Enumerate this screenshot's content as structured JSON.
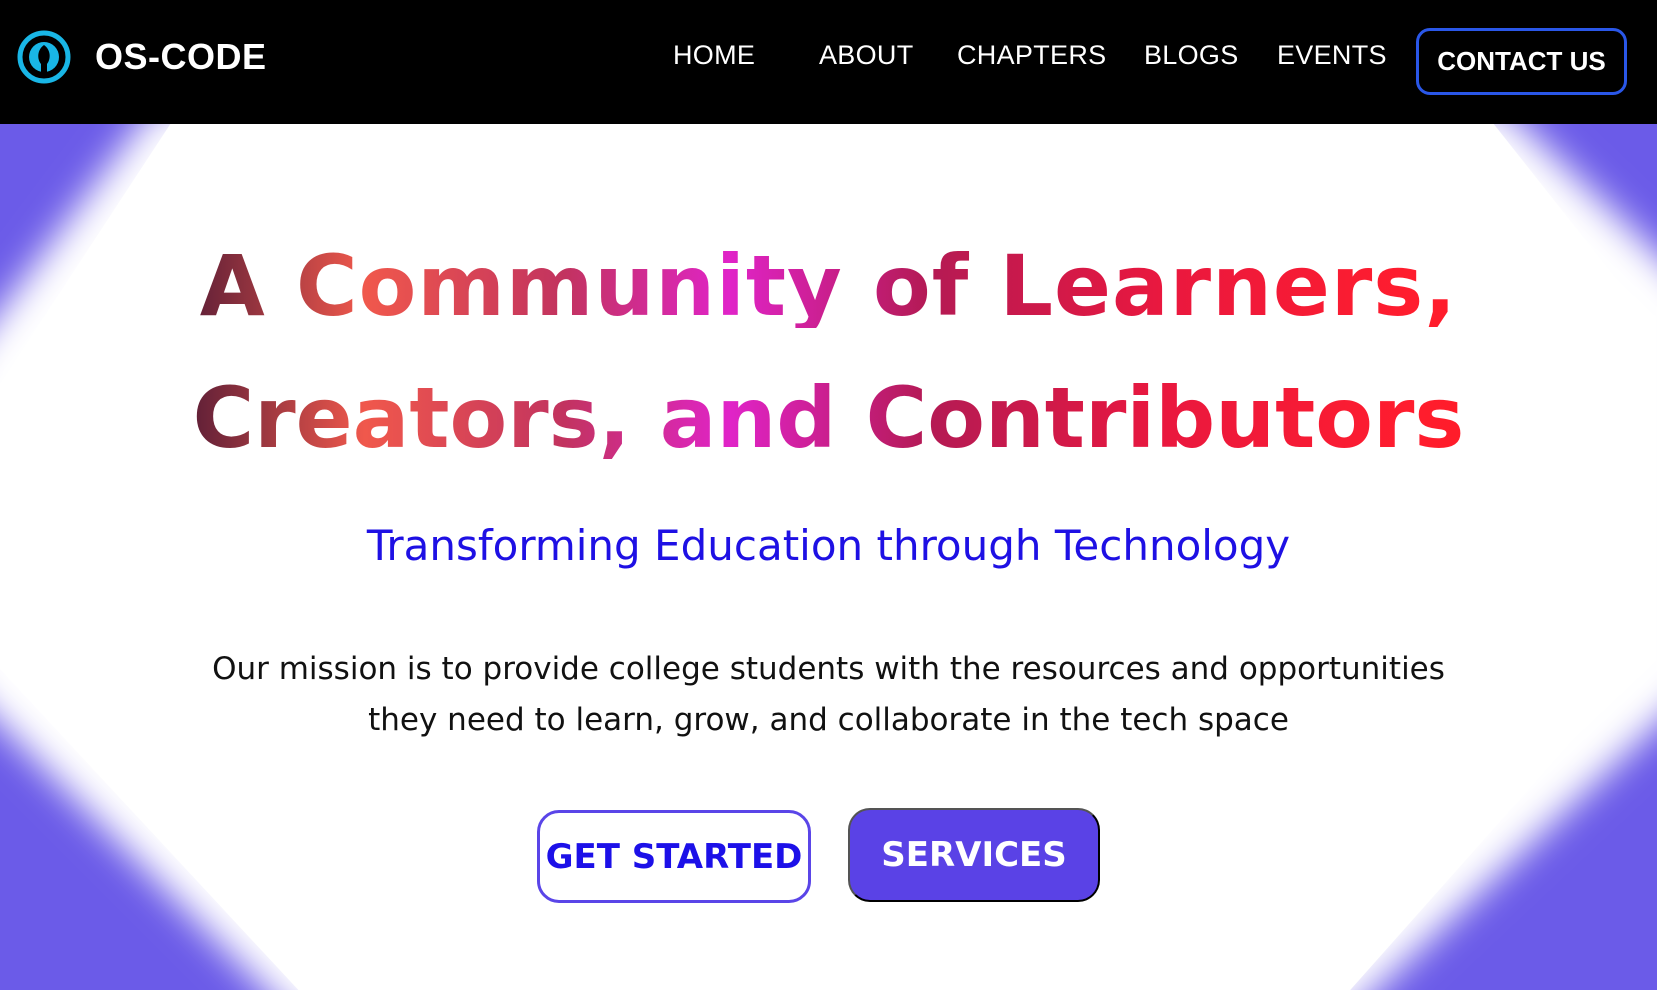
{
  "brand": {
    "name": "OS-CODE",
    "logo_icon": "os-code-logo-icon"
  },
  "nav": {
    "items": [
      {
        "label": "HOME"
      },
      {
        "label": "ABOUT"
      },
      {
        "label": "CHAPTERS"
      },
      {
        "label": "BLOGS"
      },
      {
        "label": "EVENTS"
      }
    ],
    "contact_label": "CONTACT US"
  },
  "hero": {
    "headline_line1": "A Community of Learners,",
    "headline_line2": "Creators, and Contributors",
    "tagline": "Transforming Education through Technology",
    "mission": "Our mission is to provide college students with the resources and opportunities they need to learn, grow, and collaborate in the tech space",
    "get_started_label": "GET STARTED",
    "services_label": "SERVICES"
  },
  "colors": {
    "navbar_bg": "#000000",
    "accent_purple": "#6b5be8",
    "tagline_blue": "#1e10e4",
    "services_bg": "#5a42e6",
    "contact_border": "#2a57e8",
    "logo_cyan": "#19b6e6"
  }
}
